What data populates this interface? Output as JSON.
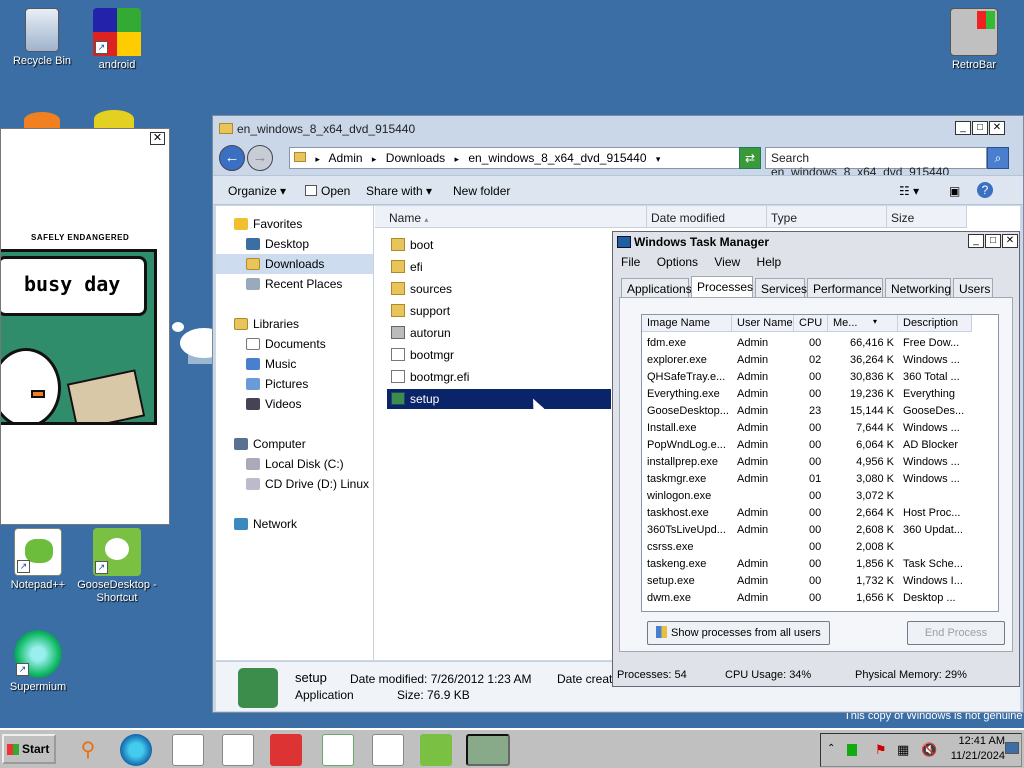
{
  "desktop": {
    "icons": [
      {
        "label": "Recycle Bin"
      },
      {
        "label": "android"
      },
      {
        "label": "RetroBar"
      },
      {
        "label": "Notepad++"
      },
      {
        "label": "GooseDesktop - Shortcut"
      },
      {
        "label": "Supermium"
      }
    ],
    "watermark": "This copy of Windows is not genuine"
  },
  "comic": {
    "close_label": "✕",
    "header": "SAFELY ENDANGERED",
    "speech": "busy day"
  },
  "explorer": {
    "title": "en_windows_8_x64_dvd_915440",
    "window_buttons": [
      "_",
      "□",
      "✕"
    ],
    "address": [
      "Admin",
      "Downloads",
      "en_windows_8_x64_dvd_915440"
    ],
    "search_placeholder": "Search en_windows_8_x64_dvd_915440",
    "toolbar": {
      "organize": "Organize",
      "open": "Open",
      "share": "Share with",
      "new_folder": "New folder"
    },
    "nav": {
      "favorites": "Favorites",
      "desktop": "Desktop",
      "downloads": "Downloads",
      "recent": "Recent Places",
      "libraries": "Libraries",
      "documents": "Documents",
      "music": "Music",
      "pictures": "Pictures",
      "videos": "Videos",
      "computer": "Computer",
      "local_disk": "Local Disk (C:)",
      "cd_drive": "CD Drive (D:) Linux Mi",
      "network": "Network"
    },
    "columns": [
      "Name",
      "Date modified",
      "Type",
      "Size"
    ],
    "files": [
      {
        "name": "boot",
        "kind": "folder"
      },
      {
        "name": "efi",
        "kind": "folder"
      },
      {
        "name": "sources",
        "kind": "folder"
      },
      {
        "name": "support",
        "kind": "folder"
      },
      {
        "name": "autorun",
        "kind": "file"
      },
      {
        "name": "bootmgr",
        "kind": "file"
      },
      {
        "name": "bootmgr.efi",
        "kind": "file"
      },
      {
        "name": "setup",
        "kind": "setup"
      }
    ],
    "details": {
      "name": "setup",
      "type": "Application",
      "date_modified": "Date modified: 7/26/2012 1:23 AM",
      "size": "Size: 76.9 KB",
      "date_created": "Date create"
    }
  },
  "taskmgr": {
    "title": "Windows Task Manager",
    "menu": [
      "File",
      "Options",
      "View",
      "Help"
    ],
    "tabs": [
      "Applications",
      "Processes",
      "Services",
      "Performance",
      "Networking",
      "Users"
    ],
    "columns": [
      "Image Name",
      "User Name",
      "CPU",
      "Me...",
      "Description"
    ],
    "rows": [
      [
        "fdm.exe",
        "Admin",
        "00",
        "66,416 K",
        "Free Dow..."
      ],
      [
        "explorer.exe",
        "Admin",
        "02",
        "36,264 K",
        "Windows ..."
      ],
      [
        "QHSafeTray.e...",
        "Admin",
        "00",
        "30,836 K",
        "360 Total ..."
      ],
      [
        "Everything.exe",
        "Admin",
        "00",
        "19,236 K",
        "Everything"
      ],
      [
        "GooseDesktop...",
        "Admin",
        "23",
        "15,144 K",
        "GooseDes..."
      ],
      [
        "Install.exe",
        "Admin",
        "00",
        "7,644 K",
        "Windows ..."
      ],
      [
        "PopWndLog.e...",
        "Admin",
        "00",
        "6,064 K",
        "AD Blocker"
      ],
      [
        "installprep.exe",
        "Admin",
        "00",
        "4,956 K",
        "Windows ..."
      ],
      [
        "taskmgr.exe",
        "Admin",
        "01",
        "3,080 K",
        "Windows ..."
      ],
      [
        "winlogon.exe",
        "",
        "00",
        "3,072 K",
        ""
      ],
      [
        "taskhost.exe",
        "Admin",
        "00",
        "2,664 K",
        "Host Proc..."
      ],
      [
        "360TsLiveUpd...",
        "Admin",
        "00",
        "2,608 K",
        "360 Updat..."
      ],
      [
        "csrss.exe",
        "",
        "00",
        "2,008 K",
        ""
      ],
      [
        "taskeng.exe",
        "Admin",
        "00",
        "1,856 K",
        "Task Sche..."
      ],
      [
        "setup.exe",
        "Admin",
        "00",
        "1,732 K",
        "Windows I..."
      ],
      [
        "dwm.exe",
        "Admin",
        "00",
        "1,656 K",
        "Desktop ..."
      ]
    ],
    "show_all_label": "Show processes from all users",
    "end_process_label": "End Process",
    "status": {
      "processes": "Processes: 54",
      "cpu": "CPU Usage: 34%",
      "memory": "Physical Memory: 29%"
    }
  },
  "taskbar": {
    "start_label": "Start",
    "clock_time": "12:41 AM",
    "clock_date": "11/21/2024"
  }
}
